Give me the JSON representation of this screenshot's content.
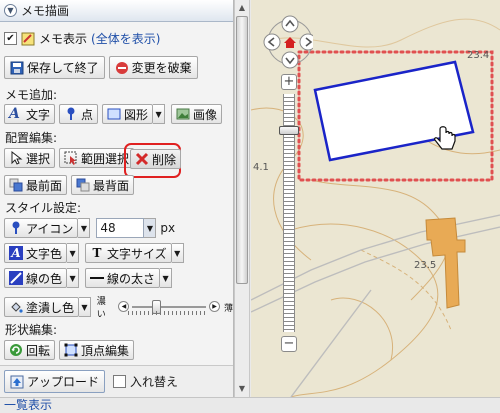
{
  "panel": {
    "title": "メモ描画",
    "show_memo_label": "メモ表示",
    "show_all_link": "(全体を表示)",
    "save_button": "保存して終了",
    "discard_button": "変更を破棄",
    "add_memo_label": "メモ追加:",
    "add_text": "文字",
    "add_point": "点",
    "add_shape": "図形",
    "add_image": "画像",
    "arrange_label": "配置編集:",
    "select_button": "選択",
    "range_select_button": "範囲選択",
    "delete_button": "削除",
    "bring_front": "最前面",
    "send_back": "最背面",
    "style_label": "スタイル設定:",
    "icon_select": "アイコン",
    "size_value": "48",
    "size_unit": "px",
    "text_color": "文字色",
    "text_size": "文字サイズ",
    "line_color": "線の色",
    "line_width": "線の太さ",
    "fill_color": "塗潰し色",
    "opacity_dark": "濃い",
    "opacity_light": "薄",
    "opacity_value": 0.3,
    "shape_edit_label": "形状編集:",
    "rotate_button": "回転",
    "vertex_edit_button": "頂点編集",
    "upload_button": "アップロード",
    "swap_label": "入れ替え"
  },
  "footer": {
    "list_view_link": "一覧表示"
  },
  "map": {
    "labels": [
      "23.4",
      "23.5",
      "4.1"
    ]
  },
  "colors": {
    "selection_outline": "#e05050",
    "rect_stroke": "#1a24c8",
    "building": "#e8aa55",
    "highlight_ring": "#e02020"
  }
}
